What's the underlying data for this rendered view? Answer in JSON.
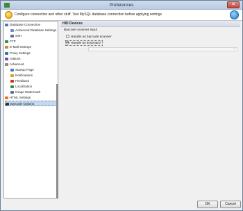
{
  "window": {
    "title": "Preferences",
    "close_glyph": "✕"
  },
  "banner": {
    "text": "Configure connection and other stuff. Test MySQL database connection before applying settings"
  },
  "tree": {
    "items": [
      {
        "label": "Database Connection",
        "indent": 0,
        "icon": "database-icon",
        "icon_color": "#4a78b8",
        "selected": false
      },
      {
        "label": "Advanced Database Settings",
        "indent": 1,
        "icon": "settings-icon",
        "icon_color": "#6b8ec4",
        "selected": false
      },
      {
        "label": "SSH",
        "indent": 1,
        "icon": "ssh-icon",
        "icon_color": "#5a6fa0",
        "selected": false
      },
      {
        "label": "FTP",
        "indent": 0,
        "icon": "ftp-icon",
        "icon_color": "#3b8a4a",
        "selected": false
      },
      {
        "label": "E-Mail Settings",
        "indent": 0,
        "icon": "email-icon",
        "icon_color": "#c98a2a",
        "selected": false
      },
      {
        "label": "Proxy Settings",
        "indent": 0,
        "icon": "proxy-icon",
        "icon_color": "#2f7a9a",
        "selected": false
      },
      {
        "label": "Addons",
        "indent": 0,
        "icon": "addons-icon",
        "icon_color": "#6a4ab0",
        "selected": false
      },
      {
        "label": "Advanced",
        "indent": 0,
        "icon": "advanced-icon",
        "icon_color": "#888888",
        "selected": false
      },
      {
        "label": "Startup Page",
        "indent": 1,
        "icon": "startup-icon",
        "icon_color": "#4a78b8",
        "selected": false
      },
      {
        "label": "Notifications",
        "indent": 1,
        "icon": "notifications-icon",
        "icon_color": "#d6a21e",
        "selected": false
      },
      {
        "label": "Feedback",
        "indent": 1,
        "icon": "feedback-icon",
        "icon_color": "#c9342a",
        "selected": false
      },
      {
        "label": "Localization",
        "indent": 1,
        "icon": "localization-icon",
        "icon_color": "#3b8a4a",
        "selected": false
      },
      {
        "label": "Image Watermark",
        "indent": 1,
        "icon": "watermark-icon",
        "icon_color": "#5a6fa0",
        "selected": false
      },
      {
        "label": "HTML Settings",
        "indent": 0,
        "icon": "html-icon",
        "icon_color": "#e07a22",
        "selected": false
      },
      {
        "label": "Barcode Options",
        "indent": 0,
        "icon": "barcode-icon",
        "icon_color": "#333333",
        "selected": true
      }
    ]
  },
  "content": {
    "section_title": "HID Devices",
    "input_label": "Barcode scanner input",
    "options": [
      {
        "label": "Handle as barcode scanner",
        "checked": false
      },
      {
        "label": "Handle as keyboard",
        "checked": true
      }
    ]
  },
  "buttons": {
    "ok": "OK",
    "cancel": "Cancel"
  }
}
